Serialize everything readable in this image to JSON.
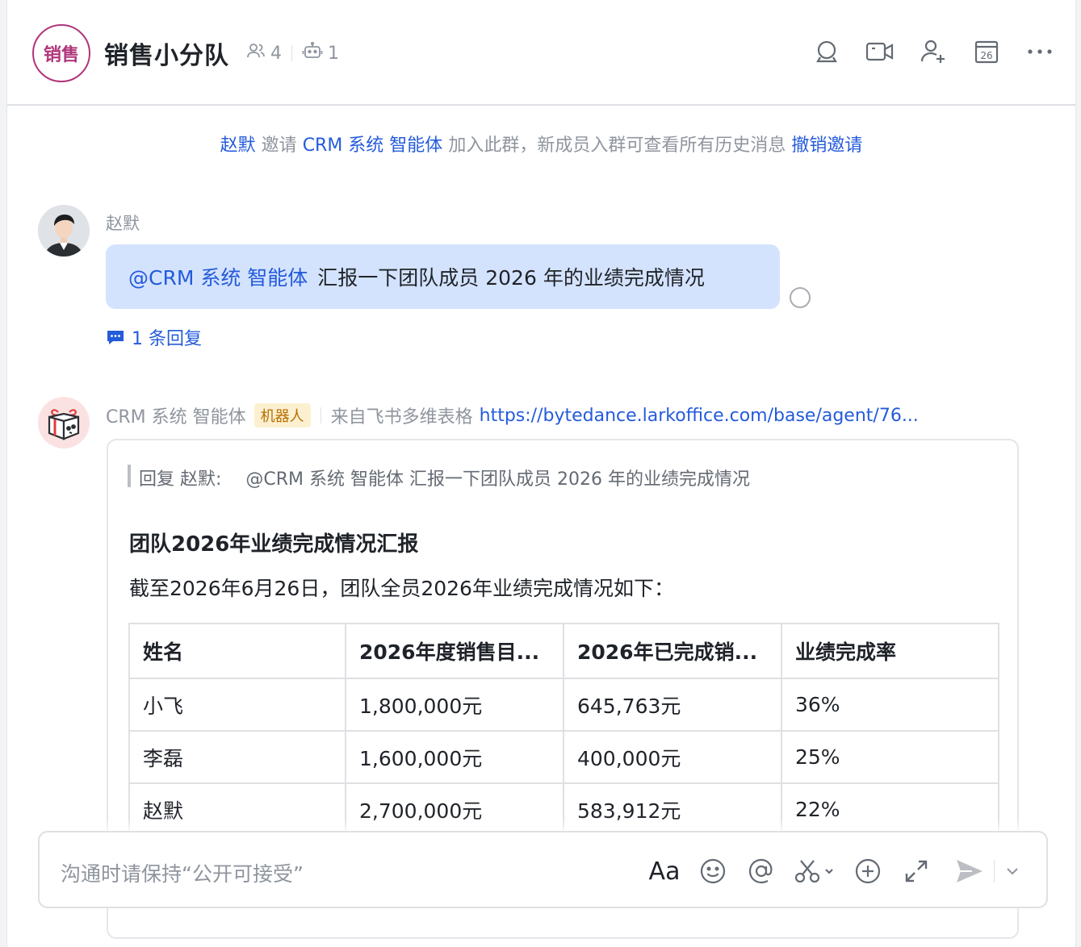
{
  "header": {
    "group_avatar_text": "销售",
    "title": "销售小分队",
    "member_count": "4",
    "bot_count": "1",
    "calendar_day": "26"
  },
  "notice": {
    "inviter": "赵默",
    "verb": "邀请",
    "invitee": "CRM 系统 智能体",
    "text": "加入此群，新成员入群可查看所有历史消息",
    "revoke_link": "撤销邀请"
  },
  "message1": {
    "sender": "赵默",
    "mention": "@CRM 系统 智能体",
    "text": "汇报一下团队成员 2026 年的业绩完成情况",
    "reply_count": "1 条回复"
  },
  "message2": {
    "sender": "CRM 系统 智能体",
    "tag": "机器人",
    "source_prefix": "来自飞书多维表格",
    "source_link": "https://bytedance.larkoffice.com/base/agent/76...",
    "quote_label": "回复 赵默:",
    "quote_text": "@CRM 系统 智能体 汇报一下团队成员 2026 年的业绩完成情况",
    "title": "团队2026年业绩完成情况汇报",
    "desc": "截至2026年6月26日，团队全员2026年业绩完成情况如下：",
    "table": {
      "headers": [
        "姓名",
        "2026年度销售目...",
        "2026年已完成销...",
        "业绩完成率"
      ],
      "rows": [
        [
          "小飞",
          "1,800,000元",
          "645,763元",
          "36%"
        ],
        [
          "李磊",
          "1,600,000元",
          "400,000元",
          "25%"
        ],
        [
          "赵默",
          "2,700,000元",
          "583,912元",
          "22%"
        ]
      ]
    }
  },
  "input": {
    "placeholder": "沟通时请保持“公开可接受”",
    "format_label": "Aa"
  },
  "colors": {
    "accent": "#245bdb",
    "bubble": "#d4e3fd",
    "brand": "#b0357a"
  }
}
